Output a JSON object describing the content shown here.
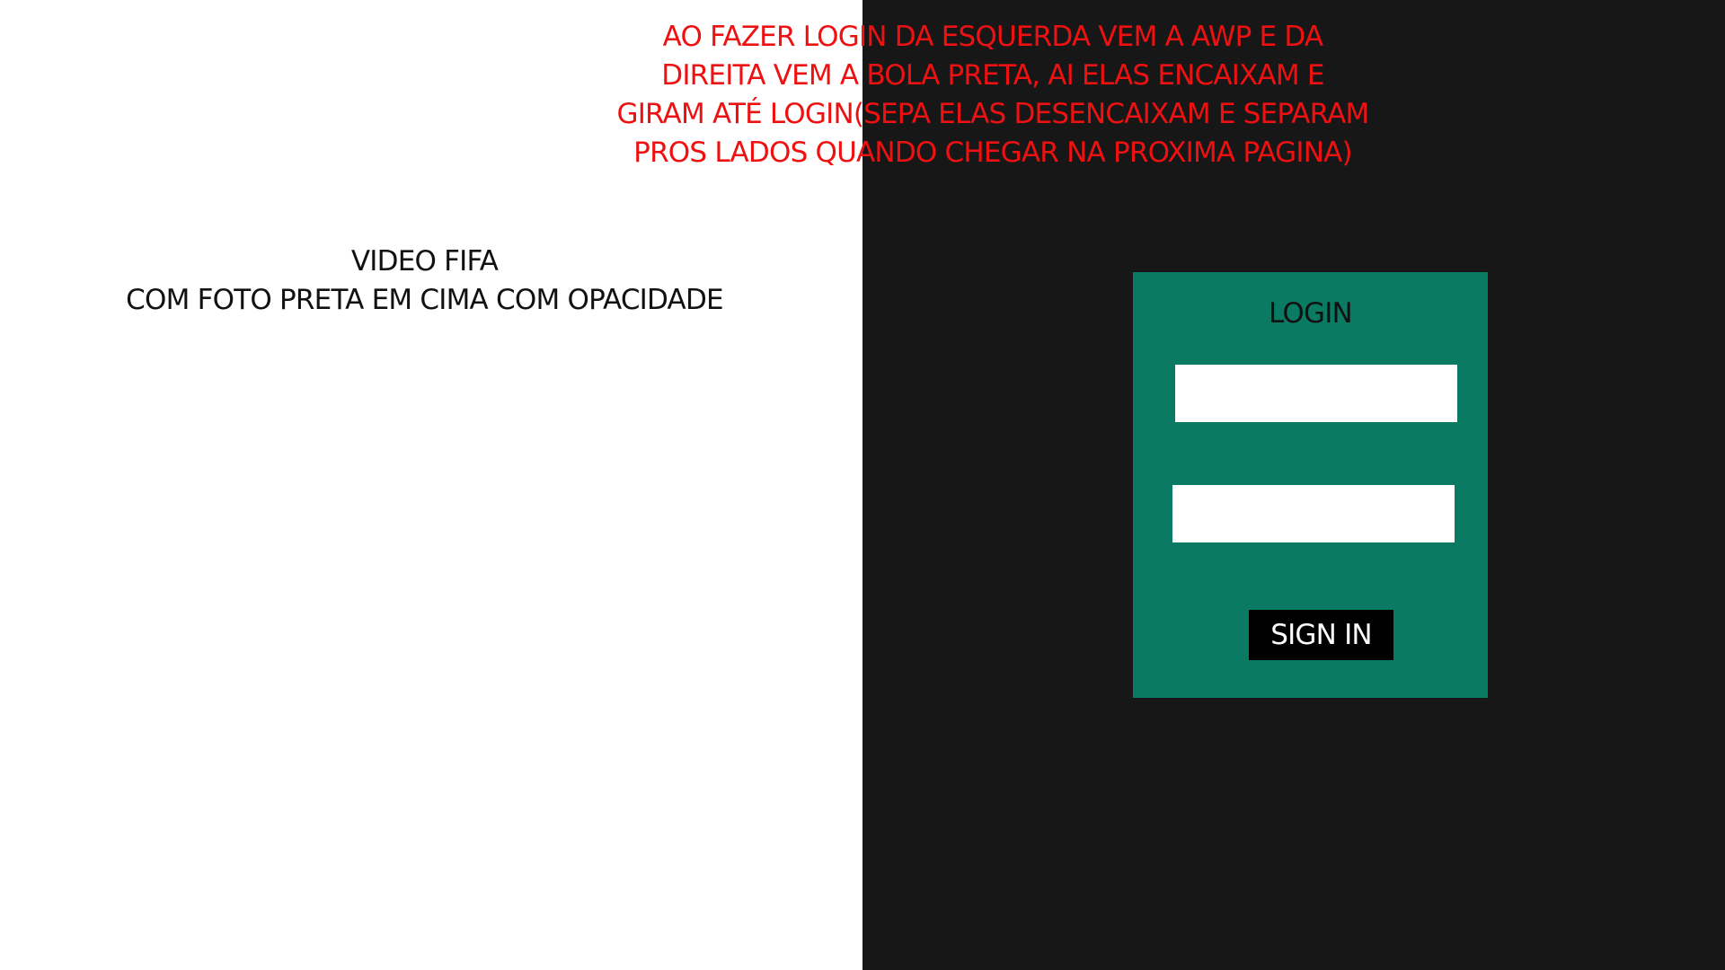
{
  "annotation_note": {
    "lines": [
      "AO FAZER LOGIN DA ESQUERDA VEM A AWP E DA",
      "DIREITA VEM A BOLA PRETA, AI ELAS ENCAIXAM E",
      "GIRAM ATÉ LOGIN(SEPA ELAS DESENCAIXAM E SEPARAM",
      "PROS LADOS QUANDO CHEGAR NA PROXIMA PAGINA)"
    ],
    "color": "#ee1111"
  },
  "video_caption": {
    "lines": [
      "VIDEO FIFA",
      "COM FOTO PRETA EM CIMA COM OPACIDADE"
    ]
  },
  "login_panel": {
    "title": "LOGIN",
    "username_value": "",
    "password_value": "",
    "sign_in_label": "SIGN IN",
    "panel_color": "#0b7a63"
  },
  "background": {
    "left_color": "#ffffff",
    "right_color": "#171717"
  }
}
